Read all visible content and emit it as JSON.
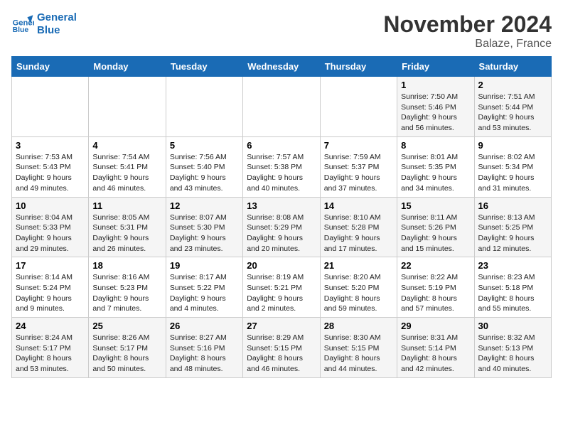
{
  "logo": {
    "line1": "General",
    "line2": "Blue"
  },
  "title": "November 2024",
  "location": "Balaze, France",
  "headers": [
    "Sunday",
    "Monday",
    "Tuesday",
    "Wednesday",
    "Thursday",
    "Friday",
    "Saturday"
  ],
  "weeks": [
    [
      {
        "day": "",
        "info": ""
      },
      {
        "day": "",
        "info": ""
      },
      {
        "day": "",
        "info": ""
      },
      {
        "day": "",
        "info": ""
      },
      {
        "day": "",
        "info": ""
      },
      {
        "day": "1",
        "info": "Sunrise: 7:50 AM\nSunset: 5:46 PM\nDaylight: 9 hours and 56 minutes."
      },
      {
        "day": "2",
        "info": "Sunrise: 7:51 AM\nSunset: 5:44 PM\nDaylight: 9 hours and 53 minutes."
      }
    ],
    [
      {
        "day": "3",
        "info": "Sunrise: 7:53 AM\nSunset: 5:43 PM\nDaylight: 9 hours and 49 minutes."
      },
      {
        "day": "4",
        "info": "Sunrise: 7:54 AM\nSunset: 5:41 PM\nDaylight: 9 hours and 46 minutes."
      },
      {
        "day": "5",
        "info": "Sunrise: 7:56 AM\nSunset: 5:40 PM\nDaylight: 9 hours and 43 minutes."
      },
      {
        "day": "6",
        "info": "Sunrise: 7:57 AM\nSunset: 5:38 PM\nDaylight: 9 hours and 40 minutes."
      },
      {
        "day": "7",
        "info": "Sunrise: 7:59 AM\nSunset: 5:37 PM\nDaylight: 9 hours and 37 minutes."
      },
      {
        "day": "8",
        "info": "Sunrise: 8:01 AM\nSunset: 5:35 PM\nDaylight: 9 hours and 34 minutes."
      },
      {
        "day": "9",
        "info": "Sunrise: 8:02 AM\nSunset: 5:34 PM\nDaylight: 9 hours and 31 minutes."
      }
    ],
    [
      {
        "day": "10",
        "info": "Sunrise: 8:04 AM\nSunset: 5:33 PM\nDaylight: 9 hours and 29 minutes."
      },
      {
        "day": "11",
        "info": "Sunrise: 8:05 AM\nSunset: 5:31 PM\nDaylight: 9 hours and 26 minutes."
      },
      {
        "day": "12",
        "info": "Sunrise: 8:07 AM\nSunset: 5:30 PM\nDaylight: 9 hours and 23 minutes."
      },
      {
        "day": "13",
        "info": "Sunrise: 8:08 AM\nSunset: 5:29 PM\nDaylight: 9 hours and 20 minutes."
      },
      {
        "day": "14",
        "info": "Sunrise: 8:10 AM\nSunset: 5:28 PM\nDaylight: 9 hours and 17 minutes."
      },
      {
        "day": "15",
        "info": "Sunrise: 8:11 AM\nSunset: 5:26 PM\nDaylight: 9 hours and 15 minutes."
      },
      {
        "day": "16",
        "info": "Sunrise: 8:13 AM\nSunset: 5:25 PM\nDaylight: 9 hours and 12 minutes."
      }
    ],
    [
      {
        "day": "17",
        "info": "Sunrise: 8:14 AM\nSunset: 5:24 PM\nDaylight: 9 hours and 9 minutes."
      },
      {
        "day": "18",
        "info": "Sunrise: 8:16 AM\nSunset: 5:23 PM\nDaylight: 9 hours and 7 minutes."
      },
      {
        "day": "19",
        "info": "Sunrise: 8:17 AM\nSunset: 5:22 PM\nDaylight: 9 hours and 4 minutes."
      },
      {
        "day": "20",
        "info": "Sunrise: 8:19 AM\nSunset: 5:21 PM\nDaylight: 9 hours and 2 minutes."
      },
      {
        "day": "21",
        "info": "Sunrise: 8:20 AM\nSunset: 5:20 PM\nDaylight: 8 hours and 59 minutes."
      },
      {
        "day": "22",
        "info": "Sunrise: 8:22 AM\nSunset: 5:19 PM\nDaylight: 8 hours and 57 minutes."
      },
      {
        "day": "23",
        "info": "Sunrise: 8:23 AM\nSunset: 5:18 PM\nDaylight: 8 hours and 55 minutes."
      }
    ],
    [
      {
        "day": "24",
        "info": "Sunrise: 8:24 AM\nSunset: 5:17 PM\nDaylight: 8 hours and 53 minutes."
      },
      {
        "day": "25",
        "info": "Sunrise: 8:26 AM\nSunset: 5:17 PM\nDaylight: 8 hours and 50 minutes."
      },
      {
        "day": "26",
        "info": "Sunrise: 8:27 AM\nSunset: 5:16 PM\nDaylight: 8 hours and 48 minutes."
      },
      {
        "day": "27",
        "info": "Sunrise: 8:29 AM\nSunset: 5:15 PM\nDaylight: 8 hours and 46 minutes."
      },
      {
        "day": "28",
        "info": "Sunrise: 8:30 AM\nSunset: 5:15 PM\nDaylight: 8 hours and 44 minutes."
      },
      {
        "day": "29",
        "info": "Sunrise: 8:31 AM\nSunset: 5:14 PM\nDaylight: 8 hours and 42 minutes."
      },
      {
        "day": "30",
        "info": "Sunrise: 8:32 AM\nSunset: 5:13 PM\nDaylight: 8 hours and 40 minutes."
      }
    ]
  ]
}
